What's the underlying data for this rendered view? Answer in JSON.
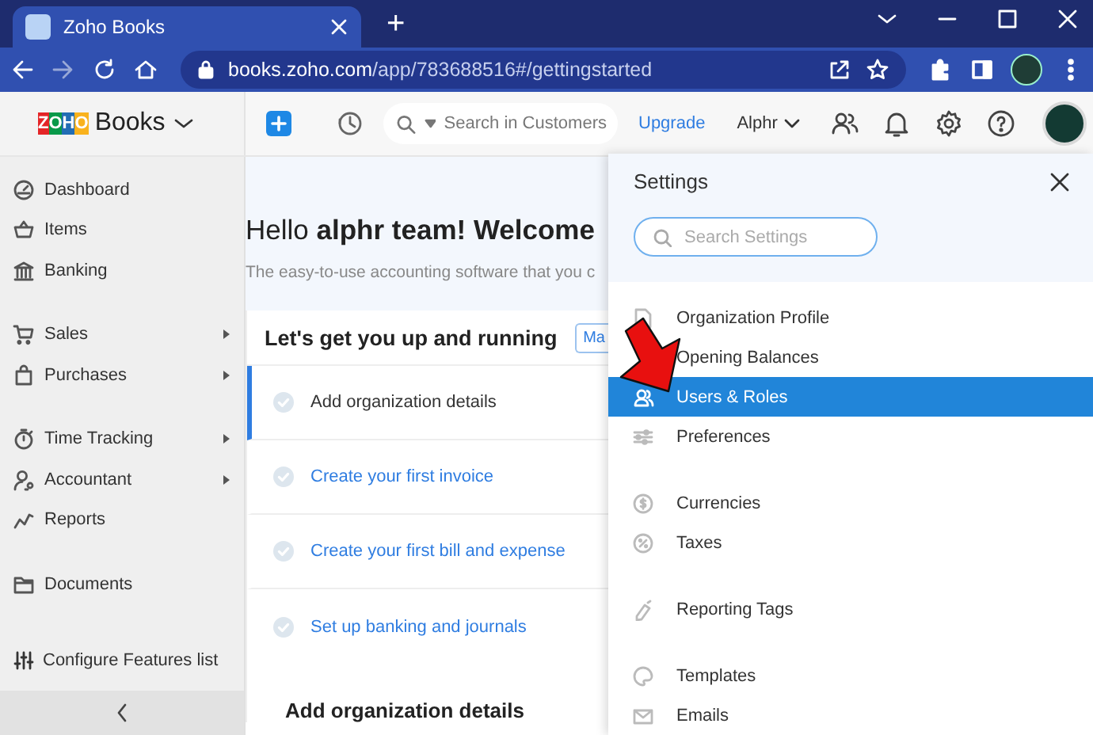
{
  "browser": {
    "tab": {
      "title": "Zoho Books"
    },
    "new_tab": "+",
    "url": {
      "host": "books.zoho.com",
      "path": "/app/783688516#/gettingstarted"
    }
  },
  "app_header": {
    "logo": "ZOHO",
    "product": "Books",
    "search": {
      "placeholder": "Search in Customers"
    },
    "upgrade": "Upgrade",
    "organization": "Alphr"
  },
  "sidebar": {
    "groups": [
      [
        {
          "label": "Dashboard",
          "submenu": false
        },
        {
          "label": "Items",
          "submenu": false
        },
        {
          "label": "Banking",
          "submenu": false
        }
      ],
      [
        {
          "label": "Sales",
          "submenu": true
        },
        {
          "label": "Purchases",
          "submenu": true
        }
      ],
      [
        {
          "label": "Time Tracking",
          "submenu": true
        },
        {
          "label": "Accountant",
          "submenu": true
        },
        {
          "label": "Reports",
          "submenu": false
        }
      ],
      [
        {
          "label": "Documents",
          "submenu": false
        }
      ]
    ],
    "footer": "Configure Features list"
  },
  "main": {
    "greeting": "Hello **alphr team! Welcome**",
    "subtitle": "The easy-to-use accounting software that you c",
    "card": {
      "title": "Let's get you up and running",
      "button": "Ma",
      "steps": [
        {
          "label": "Add organization details",
          "selected": true
        },
        {
          "label": "Create your first invoice",
          "selected": false
        },
        {
          "label": "Create your first bill and expense",
          "selected": false
        },
        {
          "label": "Set up banking and journals",
          "selected": false
        }
      ],
      "section_title": "Add organization details"
    }
  },
  "settings": {
    "title": "Settings",
    "search": {
      "placeholder": "Search Settings"
    },
    "groups": [
      [
        {
          "label": "Organization Profile",
          "selected": false
        },
        {
          "label": "Opening Balances",
          "selected": false
        },
        {
          "label": "Users & Roles",
          "selected": true
        },
        {
          "label": "Preferences",
          "selected": false
        }
      ],
      [
        {
          "label": "Currencies",
          "selected": false
        },
        {
          "label": "Taxes",
          "selected": false
        }
      ],
      [
        {
          "label": "Reporting Tags",
          "selected": false
        }
      ],
      [
        {
          "label": "Templates",
          "selected": false
        },
        {
          "label": "Emails",
          "selected": false
        }
      ]
    ]
  }
}
